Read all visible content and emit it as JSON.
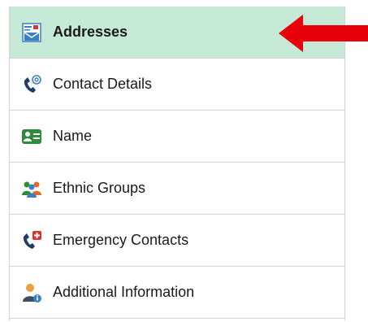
{
  "nav": {
    "items": [
      {
        "label": "Addresses",
        "icon": "addresses-icon",
        "active": true
      },
      {
        "label": "Contact Details",
        "icon": "contact-details-icon",
        "active": false
      },
      {
        "label": "Name",
        "icon": "name-card-icon",
        "active": false
      },
      {
        "label": "Ethnic Groups",
        "icon": "ethnic-groups-icon",
        "active": false
      },
      {
        "label": "Emergency Contacts",
        "icon": "emergency-contacts-icon",
        "active": false
      },
      {
        "label": "Additional Information",
        "icon": "additional-information-icon",
        "active": false
      }
    ]
  },
  "colors": {
    "active_bg": "#c6e8d7",
    "arrow": "#e8000b"
  }
}
